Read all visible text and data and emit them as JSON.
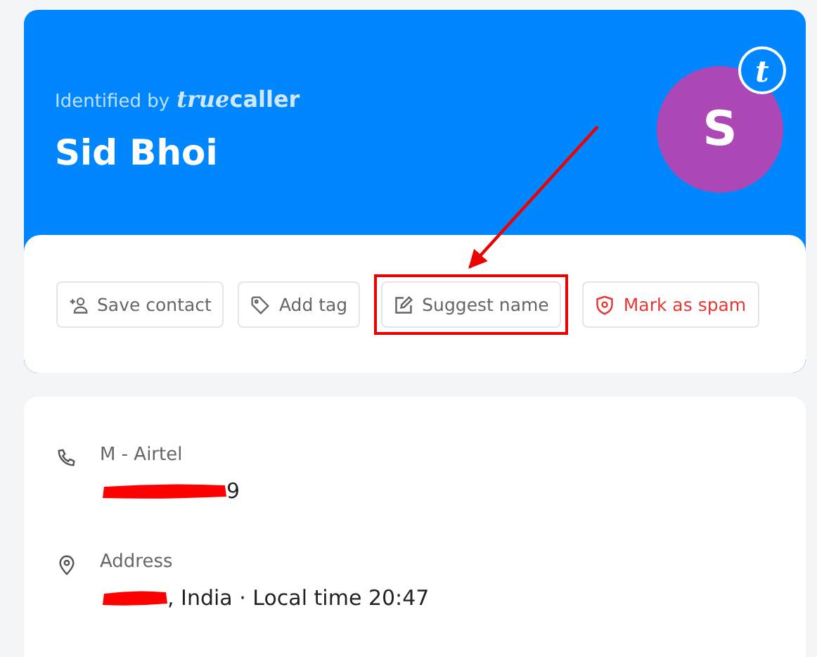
{
  "header": {
    "identified_by": "Identified by",
    "logo_italic": "true",
    "logo_rest": "caller",
    "name": "Sid Bhoi",
    "avatar_initial": "S",
    "badge_letter": "t"
  },
  "actions": [
    {
      "kind": "save",
      "label": "Save contact",
      "highlighted": false
    },
    {
      "kind": "tag",
      "label": "Add tag",
      "highlighted": false
    },
    {
      "kind": "suggest",
      "label": "Suggest name",
      "highlighted": true
    },
    {
      "kind": "spam",
      "label": "Mark as spam",
      "highlighted": false
    }
  ],
  "details": [
    {
      "kind": "phone",
      "label": "M - Airtel",
      "value": "9"
    },
    {
      "kind": "address",
      "label": "Address",
      "value": ", India · Local time 20:47"
    }
  ]
}
